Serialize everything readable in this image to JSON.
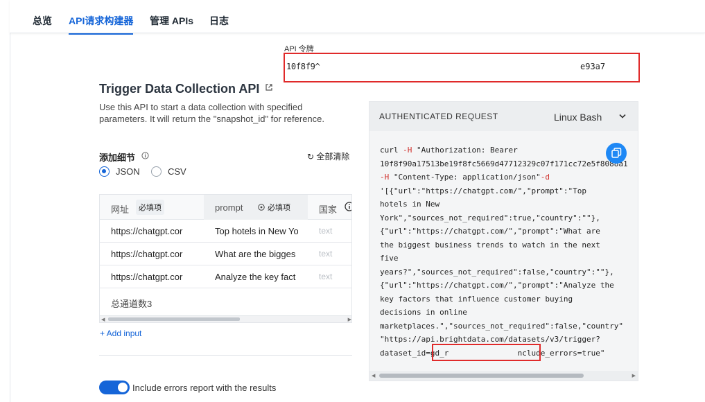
{
  "tabs": [
    {
      "label": "总览"
    },
    {
      "label": "API请求构建器"
    },
    {
      "label": "管理 APIs"
    },
    {
      "label": "日志"
    }
  ],
  "token": {
    "label": "API 令牌",
    "value_start": "10f8f9^",
    "value_end": "e93a7"
  },
  "title": "Trigger Data Collection API",
  "description": "Use this API to start a data collection with specified parameters. It will return the \"snapshot_id\" for reference.",
  "details": {
    "label": "添加细节",
    "clear_all": "全部清除",
    "formats": [
      "JSON",
      "CSV"
    ],
    "selected_format": "JSON"
  },
  "table": {
    "headers": [
      {
        "label": "网址",
        "badge": "必填项"
      },
      {
        "label": "prompt",
        "badge": "必填项"
      },
      {
        "label": "国家"
      }
    ],
    "rows": [
      {
        "url": "https://chatgpt.cor",
        "prompt": "Top hotels in New Yo",
        "country": "text"
      },
      {
        "url": "https://chatgpt.cor",
        "prompt": "What are the bigges",
        "country": "text"
      },
      {
        "url": "https://chatgpt.cor",
        "prompt": "Analyze the key fact",
        "country": "text"
      }
    ],
    "total": "总通道数3"
  },
  "add_input": "+ Add input",
  "toggle": {
    "label": "Include errors report with the results",
    "on": true
  },
  "code": {
    "title": "AUTHENTICATED REQUEST",
    "language": "Linux Bash",
    "lines": [
      "curl -H \"Authorization: Bearer",
      "10f8f90a17513be19f8fc5669d47712329c07f171cc72e5f8088a1",
      "-H \"Content-Type: application/json\" -d",
      "'[{\"url\":\"https://chatgpt.com/\",\"prompt\":\"Top",
      "hotels in New",
      "York\",\"sources_not_required\":true,\"country\":\"\"},",
      "{\"url\":\"https://chatgpt.com/\",\"prompt\":\"What are",
      "the biggest business trends to watch in the next",
      "five",
      "years?\",\"sources_not_required\":false,\"country\":\"\"},",
      "{\"url\":\"https://chatgpt.com/\",\"prompt\":\"Analyze the",
      "key factors that influence customer buying",
      "decisions in online",
      "marketplaces.\",\"sources_not_required\":false,\"country\"",
      "\"https://api.brightdata.com/datasets/v3/trigger?",
      "dataset_id=gd_r          bjm&include_errors=true\""
    ]
  },
  "colors": {
    "accent": "#1565d8",
    "highlight_box": "#e02a2a",
    "copy_button": "#1e88f5"
  }
}
